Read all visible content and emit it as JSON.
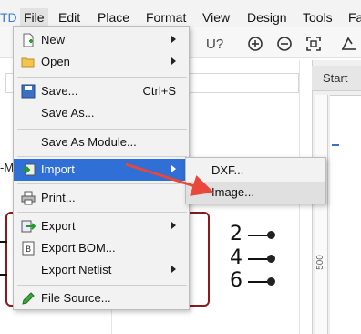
{
  "menubar": {
    "app_fragment": "TD",
    "items": [
      "File",
      "Edit",
      "Place",
      "Format",
      "View",
      "Design",
      "Tools",
      "Fa"
    ]
  },
  "toolbar": {
    "icons": [
      "underline-u-icon",
      "zoom-in-icon",
      "zoom-out-icon",
      "fit-screen-icon",
      "rotate-icon"
    ],
    "u_glyph": "U?"
  },
  "background": {
    "start_tab": "Start",
    "ruler_label": "500",
    "partial_label": "-M"
  },
  "file_menu": {
    "items": [
      {
        "label": "New",
        "icon": "new-document-icon",
        "has_submenu": true
      },
      {
        "label": "Open",
        "icon": "folder-icon",
        "has_submenu": true
      },
      {
        "label": "Save...",
        "icon": "save-disk-icon",
        "shortcut": "Ctrl+S"
      },
      {
        "label": "Save As..."
      },
      {
        "label": "Save As Module..."
      },
      {
        "label": "Import",
        "icon": "import-icon",
        "has_submenu": true,
        "highlighted": true
      },
      {
        "label": "Print...",
        "icon": "printer-icon"
      },
      {
        "label": "Export",
        "icon": "export-icon",
        "has_submenu": true
      },
      {
        "label": "Export BOM...",
        "icon": "bom-icon"
      },
      {
        "label": "Export Netlist",
        "has_submenu": true
      },
      {
        "label": "File Source...",
        "icon": "pencil-icon"
      }
    ]
  },
  "import_submenu": {
    "items": [
      "DXF...",
      "Image..."
    ]
  },
  "schematic": {
    "pins": [
      "2",
      "4",
      "6"
    ]
  },
  "colors": {
    "highlight": "#2f6fd6",
    "component_border": "#8b1a1a",
    "annotation_arrow": "#e8473a"
  }
}
